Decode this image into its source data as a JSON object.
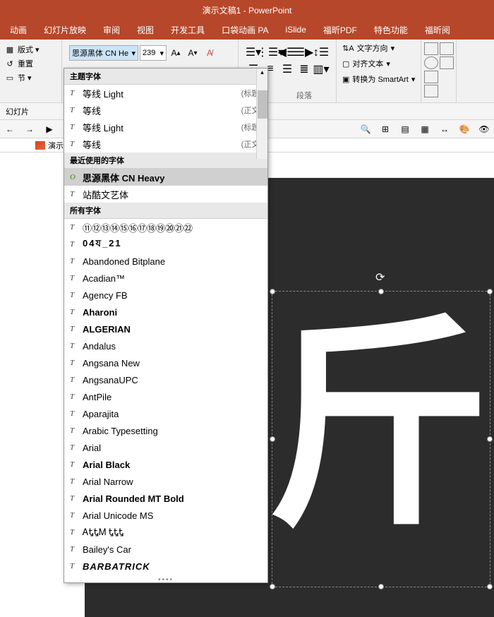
{
  "title": "演示文稿1 - PowerPoint",
  "tabs": [
    "动画",
    "幻灯片放映",
    "审阅",
    "视图",
    "开发工具",
    "口袋动画 PA",
    "iSlide",
    "福昕PDF",
    "特色功能",
    "福昕阅"
  ],
  "leftGroup": {
    "layout": "版式",
    "reset": "重置",
    "section": "节"
  },
  "font": {
    "name": "思源黑体 CN He",
    "size": "239"
  },
  "slideNav": "幻灯片",
  "slideTab": "演示",
  "textControls": {
    "direction": "文字方向",
    "align": "对齐文本",
    "smartart": "转换为 SmartArt"
  },
  "paraLabel": "段落",
  "fontDropdown": {
    "themeHeader": "主题字体",
    "recentHeader": "最近使用的字体",
    "allHeader": "所有字体",
    "themeFonts": [
      {
        "name": "等线 Light",
        "tag": "(标题)"
      },
      {
        "name": "等线",
        "tag": "(正文)"
      },
      {
        "name": "等线 Light",
        "tag": "(标题)"
      },
      {
        "name": "等线",
        "tag": "(正文)"
      }
    ],
    "recentFonts": [
      {
        "name": "思源黑体 CN Heavy",
        "selected": true,
        "icon": "O"
      },
      {
        "name": "站酷文艺体"
      }
    ],
    "allFonts": [
      "⑪⑫⑬⑭⑮⑯⑰⑱⑲⑳㉑㉒",
      "04য_21",
      "Abandoned Bitplane",
      "Acadian™",
      "Agency FB",
      "Aharoni",
      "ALGERIAN",
      "Andalus",
      "Angsana New",
      "AngsanaUPC",
      "AntPile",
      "Aparajita",
      "Arabic Typesetting",
      "Arial",
      "Arial Black",
      "Arial Narrow",
      "Arial Rounded MT Bold",
      "Arial Unicode MS",
      "ᎪᎿᎿᎷ ᎿᎿᎿ",
      "Bailey's Car",
      "BARBATRICK"
    ]
  },
  "bigChar": "斤"
}
